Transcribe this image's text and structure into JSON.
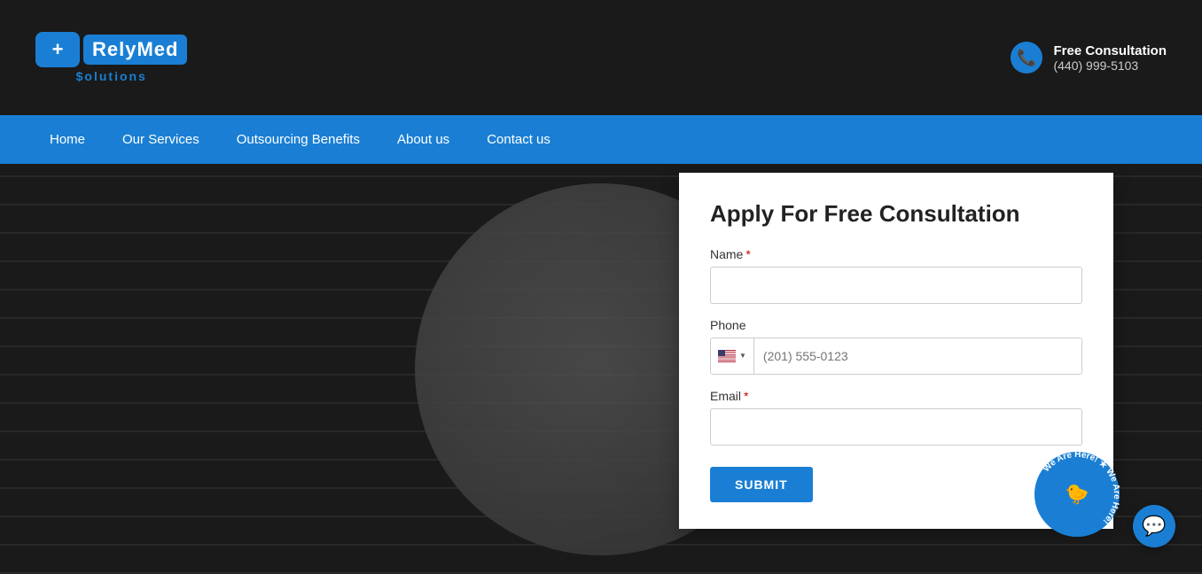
{
  "header": {
    "logo_brand": "RelyMed",
    "logo_subtitle": "$olutions",
    "logo_icon": "+",
    "free_consultation_label": "Free Consultation",
    "phone_number": "(440) 999-5103"
  },
  "navbar": {
    "items": [
      {
        "label": "Home",
        "id": "home"
      },
      {
        "label": "Our Services",
        "id": "our-services"
      },
      {
        "label": "Outsourcing Benefits",
        "id": "outsourcing-benefits"
      },
      {
        "label": "About us",
        "id": "about-us"
      },
      {
        "label": "Contact us",
        "id": "contact-us"
      }
    ]
  },
  "form": {
    "title": "Apply For Free Consultation",
    "name_label": "Name",
    "name_required": "*",
    "phone_label": "Phone",
    "phone_placeholder": "(201) 555-0123",
    "email_label": "Email",
    "email_required": "*",
    "submit_label": "SUBMIT"
  },
  "chat": {
    "badge_text": "We Are Here!",
    "icon": "💬"
  }
}
